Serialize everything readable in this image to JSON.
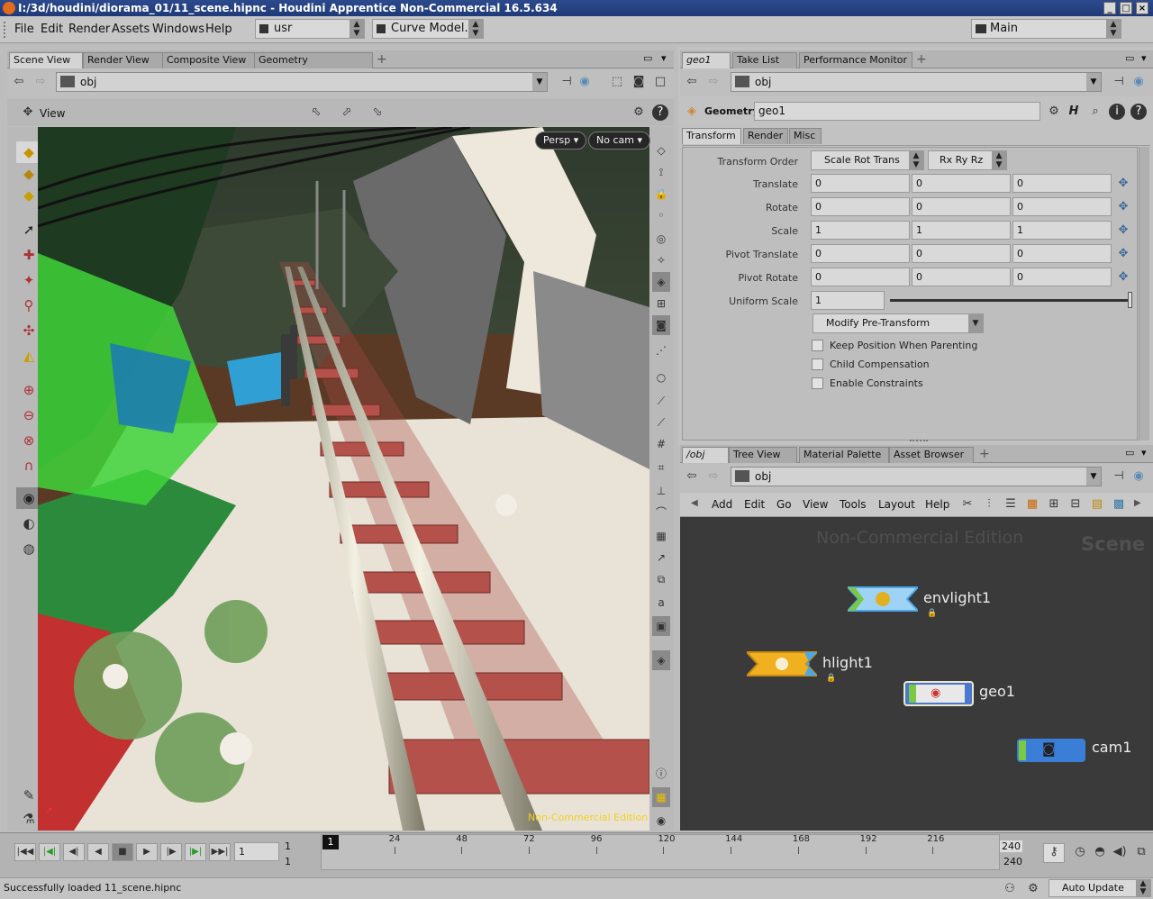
{
  "window": {
    "title": "I:/3d/houdini/diorama_01/11_scene.hipnc - Houdini Apprentice Non-Commercial 16.5.634"
  },
  "menubar": {
    "items": [
      "File",
      "Edit",
      "Render",
      "Assets",
      "Windows",
      "Help"
    ],
    "desktop_combo": "usr",
    "shelf_combo": "Curve Model...",
    "main_combo": "Main"
  },
  "left_panel": {
    "tabs": [
      "Scene View",
      "Render View",
      "Composite View",
      "Geometry Spreadsheet"
    ],
    "path": "obj",
    "view_label": "View",
    "persp_button": "Persp",
    "cam_button": "No cam",
    "watermark": "Non-Commercial Edition"
  },
  "parm_panel": {
    "tabs": [
      "geo1",
      "Take List",
      "Performance Monitor"
    ],
    "path": "obj",
    "node_type": "Geometry",
    "node_name": "geo1",
    "subtabs": [
      "Transform",
      "Render",
      "Misc"
    ],
    "transform_order_label": "Transform Order",
    "transform_order": "Scale Rot Trans",
    "rotate_order": "Rx Ry Rz",
    "rows": [
      {
        "label": "Translate",
        "values": [
          "0",
          "0",
          "0"
        ]
      },
      {
        "label": "Rotate",
        "values": [
          "0",
          "0",
          "0"
        ]
      },
      {
        "label": "Scale",
        "values": [
          "1",
          "1",
          "1"
        ]
      },
      {
        "label": "Pivot Translate",
        "values": [
          "0",
          "0",
          "0"
        ]
      },
      {
        "label": "Pivot Rotate",
        "values": [
          "0",
          "0",
          "0"
        ]
      }
    ],
    "uniform_scale_label": "Uniform Scale",
    "uniform_scale": "1",
    "pretransform_menu": "Modify Pre-Transform",
    "checkboxes": [
      "Keep Position When Parenting",
      "Child Compensation",
      "Enable Constraints"
    ]
  },
  "network_panel": {
    "tabs": [
      "/obj",
      "Tree View",
      "Material Palette",
      "Asset Browser"
    ],
    "path": "obj",
    "menu": [
      "Add",
      "Edit",
      "Go",
      "View",
      "Tools",
      "Layout",
      "Help"
    ],
    "watermark": "Non-Commercial Edition",
    "context_label": "Scene",
    "nodes": [
      "envlight1",
      "hlight1",
      "geo1",
      "cam1"
    ],
    "colors": {
      "envlight": "#4aa7e8",
      "hlight": "#f0b020",
      "geo": "#4a78d0",
      "cam": "#3a7ed8",
      "active_green": "#7ac943"
    }
  },
  "timeline": {
    "current_frame": "1",
    "start_frame": "1",
    "start_frame2": "1",
    "end_frame": "240",
    "end_frame2": "240",
    "ticks": [
      "1",
      "24",
      "48",
      "72",
      "96",
      "120",
      "144",
      "168",
      "192",
      "216",
      "240"
    ],
    "auto_update": "Auto Update"
  },
  "status": {
    "message": "Successfully loaded 11_scene.hipnc"
  }
}
